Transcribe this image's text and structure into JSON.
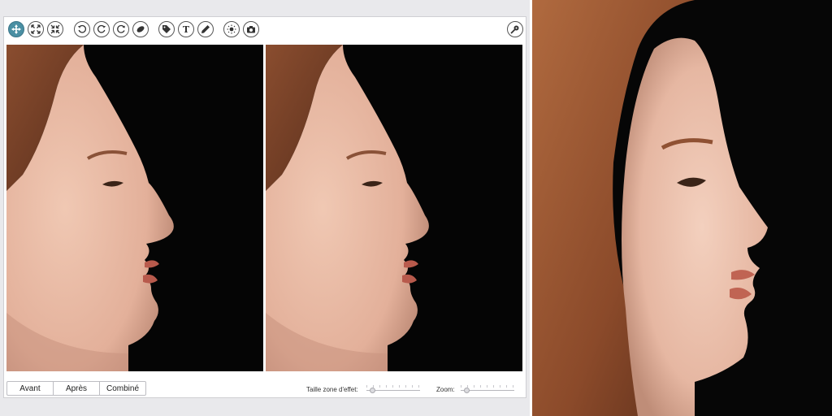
{
  "toolbar": {
    "tools": [
      {
        "icon": "move-icon"
      },
      {
        "icon": "zoom-in-arrows-icon"
      },
      {
        "icon": "zoom-out-arrows-icon"
      },
      {
        "icon": "rotate-left-icon"
      },
      {
        "icon": "rotate-right-icon"
      },
      {
        "icon": "reset-rotation-icon"
      },
      {
        "icon": "eraser-icon"
      },
      {
        "icon": "tag-icon"
      },
      {
        "icon": "text-tool-icon"
      },
      {
        "icon": "pencil-icon"
      },
      {
        "icon": "brightness-icon"
      },
      {
        "icon": "camera-icon"
      },
      {
        "icon": "settings-pin-icon"
      }
    ],
    "text_tool_glyph": "T"
  },
  "view_modes": {
    "before": "Avant",
    "after": "Après",
    "combined": "Combiné"
  },
  "controls": {
    "effect_size_label": "Taille zone d'effet:",
    "zoom_label": "Zoom:"
  },
  "colors": {
    "active_tool": "#4a8fa3",
    "photo_background": "#050505"
  }
}
